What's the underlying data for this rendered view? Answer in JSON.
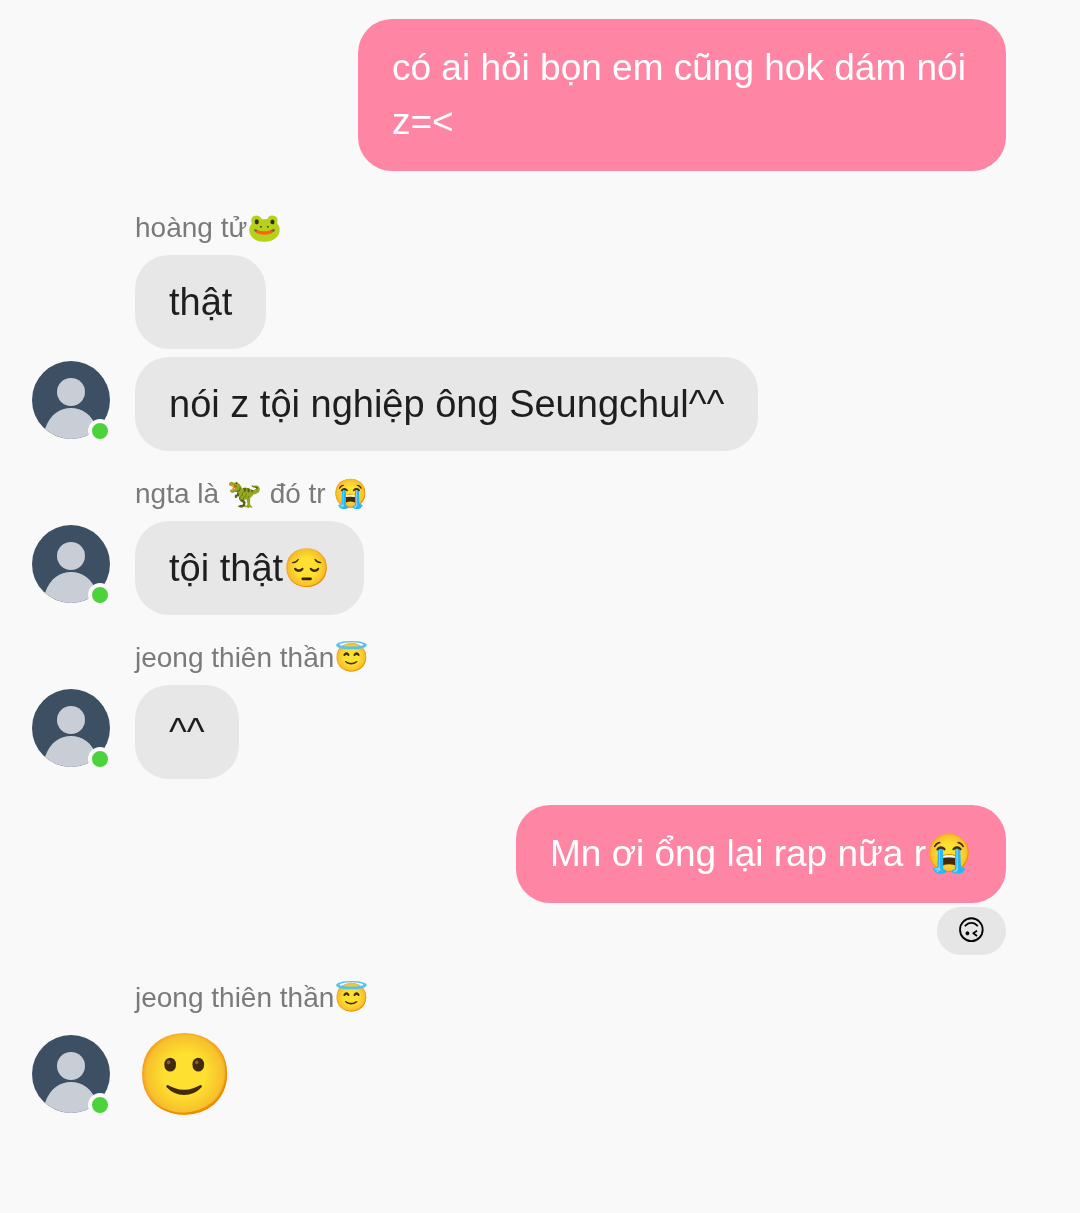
{
  "messages": [
    {
      "kind": "outgoing",
      "text": "có ai hỏi bọn em cũng hok dám nói z=<"
    },
    {
      "kind": "incoming",
      "sender": "hoàng tử🐸",
      "online": true,
      "bubbles": [
        {
          "kind": "text",
          "text": "thật"
        },
        {
          "kind": "text",
          "text": "nói z tội nghiệp ông Seungchul^^"
        }
      ]
    },
    {
      "kind": "incoming",
      "sender": "ngta là 🦖 đó tr 😭",
      "online": true,
      "bubbles": [
        {
          "kind": "text",
          "text": "tội thật😔"
        }
      ]
    },
    {
      "kind": "incoming",
      "sender": "jeong thiên thần😇",
      "online": true,
      "bubbles": [
        {
          "kind": "text",
          "text": "^^"
        }
      ]
    },
    {
      "kind": "outgoing",
      "text": "Mn ơi ổng lại rap nữa r😭",
      "reaction": "🙃"
    },
    {
      "kind": "incoming",
      "sender": "jeong thiên thần😇",
      "online": true,
      "bubbles": [
        {
          "kind": "emoji",
          "text": "🙂"
        }
      ]
    }
  ]
}
